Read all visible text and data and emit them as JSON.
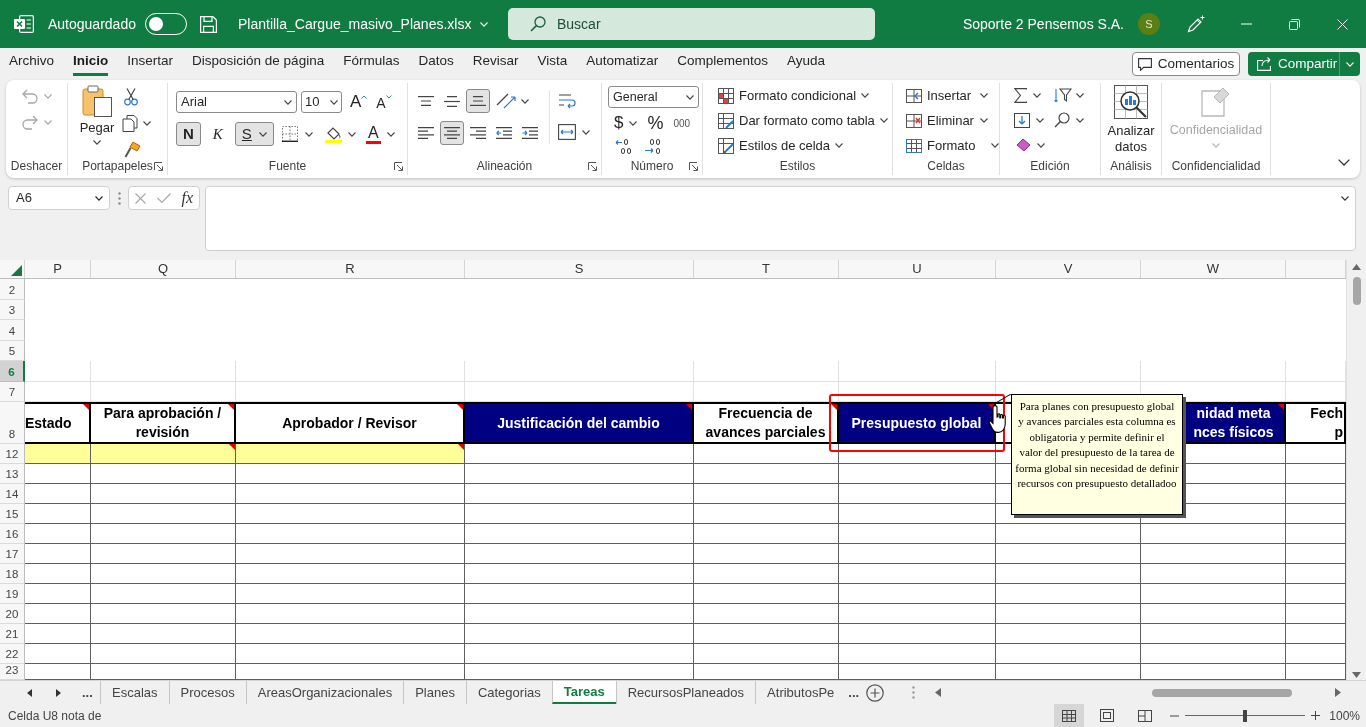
{
  "title_bar": {
    "autosave": {
      "label": "Autoguardado",
      "on": false
    },
    "file_name": "Plantilla_Cargue_masivo_Planes.xlsx",
    "search": {
      "placeholder": "Buscar"
    },
    "user_name": "Soporte 2 Pensemos S.A.",
    "avatar_initial": "S"
  },
  "ribbon_tabs": [
    {
      "label": "Archivo",
      "selected": false
    },
    {
      "label": "Inicio",
      "selected": true
    },
    {
      "label": "Insertar",
      "selected": false
    },
    {
      "label": "Disposición de página",
      "selected": false
    },
    {
      "label": "Fórmulas",
      "selected": false
    },
    {
      "label": "Datos",
      "selected": false
    },
    {
      "label": "Revisar",
      "selected": false
    },
    {
      "label": "Vista",
      "selected": false
    },
    {
      "label": "Automatizar",
      "selected": false
    },
    {
      "label": "Complementos",
      "selected": false
    },
    {
      "label": "Ayuda",
      "selected": false
    }
  ],
  "ribbon_buttons": {
    "comments": "Comentarios",
    "share": "Compartir"
  },
  "ribbon": {
    "undo": {
      "label": "Deshacer",
      "disabled": true
    },
    "clipboard": {
      "label": "Portapapeles",
      "paste": "Pegar"
    },
    "font": {
      "label": "Fuente",
      "name": "Arial",
      "size": "10",
      "grow": "A",
      "shrink": "A",
      "styles": [
        {
          "kind": "bold",
          "glyph": "N",
          "selected": true
        },
        {
          "kind": "italic",
          "glyph": "K",
          "selected": false
        },
        {
          "kind": "underline",
          "glyph": "S",
          "selected": true
        }
      ],
      "font_color": "A"
    },
    "alignment": {
      "label": "Alineación",
      "vertical": [
        {
          "kind": "top",
          "selected": false
        },
        {
          "kind": "middle",
          "selected": false
        },
        {
          "kind": "bottom",
          "selected": true
        }
      ],
      "horizontal": [
        {
          "kind": "left",
          "selected": false
        },
        {
          "kind": "center",
          "selected": true
        },
        {
          "kind": "right",
          "selected": false
        }
      ]
    },
    "number": {
      "label": "Número",
      "format": "General",
      "symbols": [
        {
          "kind": "currency",
          "glyph": "$"
        },
        {
          "kind": "percent",
          "glyph": "%"
        },
        {
          "kind": "thousands",
          "glyph": "000"
        }
      ]
    },
    "styles": {
      "label": "Estilos",
      "items": [
        {
          "kind": "conditional",
          "label": "Formato condicional"
        },
        {
          "kind": "table",
          "label": "Dar formato como tabla"
        },
        {
          "kind": "cell_styles",
          "label": "Estilos de celda"
        }
      ]
    },
    "cells": {
      "label": "Celdas",
      "items": [
        {
          "kind": "insert",
          "label": "Insertar"
        },
        {
          "kind": "delete",
          "label": "Eliminar"
        },
        {
          "kind": "format",
          "label": "Formato"
        }
      ]
    },
    "editing": {
      "label": "Edición"
    },
    "analysis": {
      "label": "Análisis",
      "button": "Analizar datos"
    },
    "sensitivity": {
      "label": "Confidencialidad",
      "button": "Confidencialidad",
      "disabled": true
    }
  },
  "formula_bar": {
    "name_box": "A6",
    "function_label": "fx"
  },
  "sheet": {
    "columns": [
      "P",
      "Q",
      "R",
      "S",
      "T",
      "U",
      "V",
      "W"
    ],
    "rows": [
      {
        "number": "2",
        "kind": "spacer",
        "selected": false
      },
      {
        "number": "3",
        "kind": "spacer",
        "selected": false
      },
      {
        "number": "4",
        "kind": "spacer",
        "selected": false
      },
      {
        "number": "5",
        "kind": "spacer",
        "selected": false
      },
      {
        "number": "6",
        "kind": "blank",
        "selected": true
      },
      {
        "number": "7",
        "kind": "blank",
        "selected": false
      },
      {
        "number": "8",
        "kind": "header",
        "selected": false,
        "cells": [
          {
            "lines": [
              "Estado"
            ],
            "kind": "light",
            "note": true,
            "marked": false
          },
          {
            "lines": [
              "Para aprobación /",
              "revisión"
            ],
            "kind": "light",
            "note": true,
            "marked": false
          },
          {
            "lines": [
              "Aprobador / Revisor"
            ],
            "kind": "light",
            "note": true,
            "marked": false
          },
          {
            "lines": [
              "Justificación del cambio"
            ],
            "kind": "dark",
            "note": true,
            "marked": false
          },
          {
            "lines": [
              "Frecuencia de",
              "avances parciales"
            ],
            "kind": "light",
            "note": true,
            "marked": false
          },
          {
            "lines": [
              "Presupuesto global"
            ],
            "kind": "dark",
            "note": true,
            "marked": true,
            "comment_lines": [
              "Para planes con presupuesto global",
              "y avances parciales esta columna es",
              "obligatoria y permite definir el",
              "valor del presupuesto de la tarea de",
              "forma global sin necesidad de definir",
              "recursos con presupuesto detalladoo"
            ]
          },
          {
            "kind": "light",
            "note": false,
            "marked": false
          },
          {
            "lines": [
              "nidad meta",
              "nces físicos"
            ],
            "kind": "dark",
            "note": true,
            "marked": false
          },
          {
            "lines": [
              "Fech",
              "p"
            ],
            "kind": "light",
            "note": false,
            "marked": false
          }
        ]
      },
      {
        "number": "12",
        "kind": "entry",
        "selected": false,
        "cells": [
          {
            "filled": true,
            "note": false
          },
          {
            "filled": true,
            "note": true
          },
          {
            "filled": true,
            "note": true
          },
          {
            "filled": false,
            "note": false
          },
          {
            "filled": false,
            "note": false
          },
          {
            "filled": false,
            "note": false
          },
          {
            "filled": false,
            "note": false
          },
          {
            "filled": false,
            "note": false
          },
          {
            "filled": false,
            "note": false
          }
        ]
      },
      {
        "number": "13",
        "kind": "data",
        "selected": false
      },
      {
        "number": "14",
        "kind": "data",
        "selected": false
      },
      {
        "number": "15",
        "kind": "data",
        "selected": false
      },
      {
        "number": "16",
        "kind": "data",
        "selected": false
      },
      {
        "number": "17",
        "kind": "data",
        "selected": false
      },
      {
        "number": "18",
        "kind": "data",
        "selected": false
      },
      {
        "number": "19",
        "kind": "data",
        "selected": false
      },
      {
        "number": "20",
        "kind": "data",
        "selected": false
      },
      {
        "number": "21",
        "kind": "data",
        "selected": false
      },
      {
        "number": "22",
        "kind": "data",
        "selected": false
      },
      {
        "number": "23",
        "kind": "data",
        "selected": false
      }
    ]
  },
  "sheet_tabs": {
    "overflow_left": "...",
    "tabs": [
      {
        "label": "Escalas",
        "selected": false
      },
      {
        "label": "Procesos",
        "selected": false
      },
      {
        "label": "AreasOrganizacionales",
        "selected": false
      },
      {
        "label": "Planes",
        "selected": false
      },
      {
        "label": "Categorias",
        "selected": false
      },
      {
        "label": "Tareas",
        "selected": true
      },
      {
        "label": "RecursosPlaneados",
        "selected": false
      },
      {
        "label": "AtributosPe",
        "selected": false
      }
    ],
    "overflow_right": "..."
  },
  "status_bar": {
    "text": "Celda U8 nota de",
    "views": [
      {
        "kind": "normal",
        "selected": true
      },
      {
        "kind": "page_layout",
        "selected": false
      },
      {
        "kind": "page_break",
        "selected": false
      }
    ],
    "zoom": {
      "level": 0.5,
      "reading": "100%"
    }
  }
}
